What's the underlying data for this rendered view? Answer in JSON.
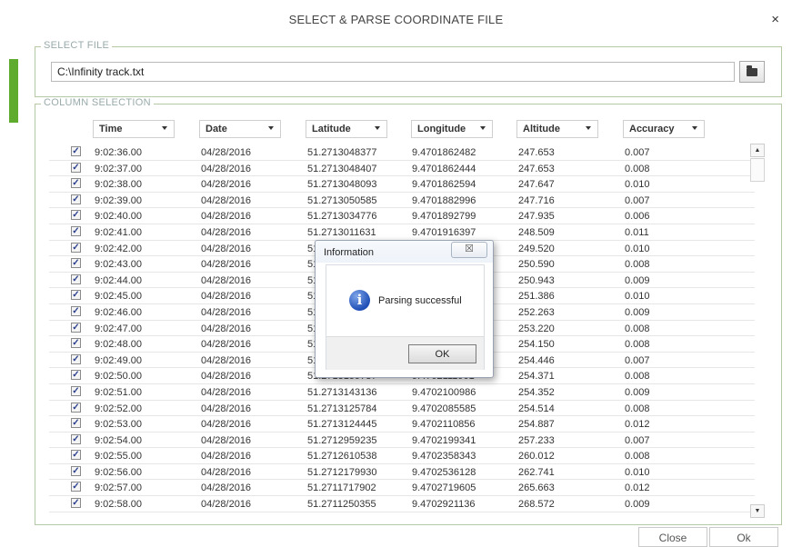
{
  "window": {
    "title": "SELECT & PARSE COORDINATE FILE",
    "close_glyph": "×"
  },
  "select_file": {
    "legend": "SELECT FILE",
    "path": "C:\\Infinity track.txt",
    "browse_icon": "folder-open-icon"
  },
  "column_selection": {
    "legend": "COLUMN SELECTION",
    "headers": [
      "Time",
      "Date",
      "Latitude",
      "Longitude",
      "Altitude",
      "Accuracy"
    ],
    "rows": [
      [
        "9:02:36.00",
        "04/28/2016",
        "51.2713048377",
        "9.4701862482",
        "247.653",
        "0.007"
      ],
      [
        "9:02:37.00",
        "04/28/2016",
        "51.2713048407",
        "9.4701862444",
        "247.653",
        "0.008"
      ],
      [
        "9:02:38.00",
        "04/28/2016",
        "51.2713048093",
        "9.4701862594",
        "247.647",
        "0.010"
      ],
      [
        "9:02:39.00",
        "04/28/2016",
        "51.2713050585",
        "9.4701882996",
        "247.716",
        "0.007"
      ],
      [
        "9:02:40.00",
        "04/28/2016",
        "51.2713034776",
        "9.4701892799",
        "247.935",
        "0.006"
      ],
      [
        "9:02:41.00",
        "04/28/2016",
        "51.2713011631",
        "9.4701916397",
        "248.509",
        "0.011"
      ],
      [
        "9:02:42.00",
        "04/28/2016",
        "51",
        "",
        "249.520",
        "0.010"
      ],
      [
        "9:02:43.00",
        "04/28/2016",
        "51",
        "",
        "250.590",
        "0.008"
      ],
      [
        "9:02:44.00",
        "04/28/2016",
        "51",
        "",
        "250.943",
        "0.009"
      ],
      [
        "9:02:45.00",
        "04/28/2016",
        "51",
        "",
        "251.386",
        "0.010"
      ],
      [
        "9:02:46.00",
        "04/28/2016",
        "51",
        "",
        "252.263",
        "0.009"
      ],
      [
        "9:02:47.00",
        "04/28/2016",
        "51",
        "",
        "253.220",
        "0.008"
      ],
      [
        "9:02:48.00",
        "04/28/2016",
        "51",
        "",
        "254.150",
        "0.008"
      ],
      [
        "9:02:49.00",
        "04/28/2016",
        "51",
        "",
        "254.446",
        "0.007"
      ],
      [
        "9:02:50.00",
        "04/28/2016",
        "51.2713159737",
        "9.4702111901",
        "254.371",
        "0.008"
      ],
      [
        "9:02:51.00",
        "04/28/2016",
        "51.2713143136",
        "9.4702100986",
        "254.352",
        "0.009"
      ],
      [
        "9:02:52.00",
        "04/28/2016",
        "51.2713125784",
        "9.4702085585",
        "254.514",
        "0.008"
      ],
      [
        "9:02:53.00",
        "04/28/2016",
        "51.2713124445",
        "9.4702110856",
        "254.887",
        "0.012"
      ],
      [
        "9:02:54.00",
        "04/28/2016",
        "51.2712959235",
        "9.4702199341",
        "257.233",
        "0.007"
      ],
      [
        "9:02:55.00",
        "04/28/2016",
        "51.2712610538",
        "9.4702358343",
        "260.012",
        "0.008"
      ],
      [
        "9:02:56.00",
        "04/28/2016",
        "51.2712179930",
        "9.4702536128",
        "262.741",
        "0.010"
      ],
      [
        "9:02:57.00",
        "04/28/2016",
        "51.2711717902",
        "9.4702719605",
        "265.663",
        "0.012"
      ],
      [
        "9:02:58.00",
        "04/28/2016",
        "51.2711250355",
        "9.4702921136",
        "268.572",
        "0.009"
      ]
    ]
  },
  "dialog": {
    "title": "Information",
    "message": "Parsing successful",
    "ok_label": "OK",
    "close_glyph": "☒",
    "icon": "info-icon"
  },
  "footer": {
    "close_label": "Close",
    "ok_label": "Ok"
  }
}
